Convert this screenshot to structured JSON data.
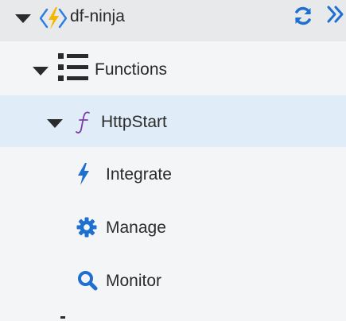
{
  "header": {
    "app_name": "df-ninja",
    "refresh_icon": "refresh-icon",
    "collapse_icon": "double-chevron-right-icon",
    "app_icon": "function-app-icon"
  },
  "tree": {
    "functions": {
      "label": "Functions",
      "icon": "list-icon"
    },
    "function": {
      "label": "HttpStart",
      "icon": "function-icon"
    },
    "children": [
      {
        "label": "Integrate",
        "icon": "lightning-bolt-icon"
      },
      {
        "label": "Manage",
        "icon": "gear-icon"
      },
      {
        "label": "Monitor",
        "icon": "magnifier-icon"
      }
    ]
  },
  "colors": {
    "accent_blue": "#1f6fd1",
    "bolt_yellow": "#f5b800",
    "function_purple": "#7a3ea0",
    "selected_row": "#e0ecf8",
    "header_bg": "#e8e9eb"
  }
}
